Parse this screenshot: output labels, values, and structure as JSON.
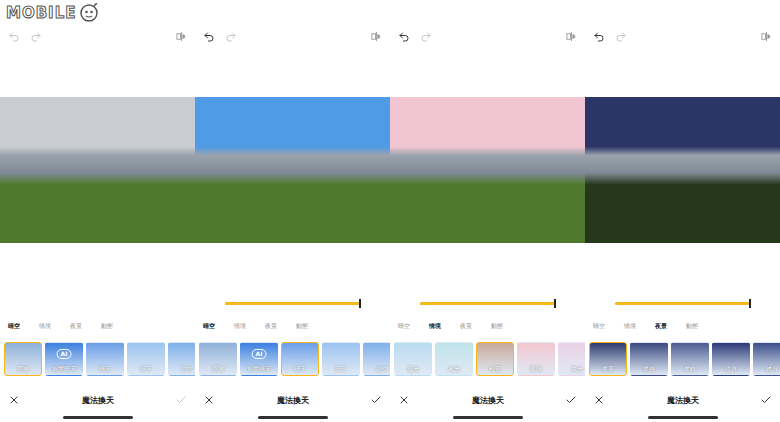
{
  "watermark": {
    "text": "MOBILE"
  },
  "panels": [
    {
      "undo_enabled": false,
      "redo_enabled": false,
      "photo": {
        "sky": "#c9ccd0",
        "ground": "#4f7a2e"
      },
      "slider": null,
      "tabs": [
        {
          "label": "晴空",
          "selected": true
        },
        {
          "label": "情境",
          "selected": false
        },
        {
          "label": "夜景",
          "selected": false
        },
        {
          "label": "動態",
          "selected": false
        }
      ],
      "thumbnails": [
        {
          "label": "原圖",
          "selected": true,
          "color": "#8fb0d8",
          "badge": ""
        },
        {
          "label": "智慧晴天",
          "selected": false,
          "color": "#3a7fe0",
          "badge": "AI"
        },
        {
          "label": "晴天",
          "selected": false,
          "color": "#6a9ee8",
          "badge": ""
        },
        {
          "label": "藍天",
          "selected": false,
          "color": "#9cc3ef",
          "badge": ""
        },
        {
          "label": "碧空",
          "selected": false,
          "color": "#7fb0ea",
          "badge": ""
        }
      ],
      "title": "魔法換天",
      "confirm_enabled": false
    },
    {
      "undo_enabled": true,
      "redo_enabled": false,
      "photo": {
        "sky": "#4f9be6",
        "ground": "#4f7a2e"
      },
      "slider": {
        "level": 1
      },
      "tabs": [
        {
          "label": "晴空",
          "selected": true
        },
        {
          "label": "情境",
          "selected": false
        },
        {
          "label": "夜景",
          "selected": false
        },
        {
          "label": "動態",
          "selected": false
        }
      ],
      "thumbnails": [
        {
          "label": "原圖",
          "selected": false,
          "color": "#8fb0d8",
          "badge": ""
        },
        {
          "label": "智慧晴天",
          "selected": false,
          "color": "#3a7fe0",
          "badge": "AI"
        },
        {
          "label": "晴天",
          "selected": true,
          "color": "#6a9ee8",
          "badge": ""
        },
        {
          "label": "藍天",
          "selected": false,
          "color": "#9cc3ef",
          "badge": ""
        },
        {
          "label": "碧空",
          "selected": false,
          "color": "#7fb0ea",
          "badge": ""
        }
      ],
      "title": "魔法換天",
      "confirm_enabled": true
    },
    {
      "undo_enabled": true,
      "redo_enabled": false,
      "photo": {
        "sky": "#f1c6d2",
        "ground": "#4f7a2e"
      },
      "slider": {
        "level": 1
      },
      "tabs": [
        {
          "label": "晴空",
          "selected": false
        },
        {
          "label": "情境",
          "selected": true
        },
        {
          "label": "夜景",
          "selected": false
        },
        {
          "label": "動態",
          "selected": false
        }
      ],
      "thumbnails": [
        {
          "label": "霞光",
          "selected": false,
          "color": "#b9dcef",
          "badge": ""
        },
        {
          "label": "暮光",
          "selected": false,
          "color": "#bfe3ea",
          "badge": ""
        },
        {
          "label": "粉霞",
          "selected": true,
          "color": "#c9a99a",
          "badge": ""
        },
        {
          "label": "暖陽",
          "selected": false,
          "color": "#f3c7cf",
          "badge": ""
        },
        {
          "label": "晨光",
          "selected": false,
          "color": "#ecd2e6",
          "badge": ""
        }
      ],
      "title": "魔法換天",
      "confirm_enabled": true
    },
    {
      "undo_enabled": true,
      "redo_enabled": false,
      "photo": {
        "sky": "#2b3566",
        "ground": "#26381c"
      },
      "slider": {
        "level": 1
      },
      "tabs": [
        {
          "label": "晴空",
          "selected": false
        },
        {
          "label": "情境",
          "selected": false
        },
        {
          "label": "夜景",
          "selected": true
        },
        {
          "label": "動態",
          "selected": false
        }
      ],
      "thumbnails": [
        {
          "label": "星辰",
          "selected": true,
          "color": "#2e3b6e",
          "badge": ""
        },
        {
          "label": "星跡",
          "selected": false,
          "color": "#3a4a80",
          "badge": ""
        },
        {
          "label": "星軌",
          "selected": false,
          "color": "#4a5c90",
          "badge": ""
        },
        {
          "label": "弦月",
          "selected": false,
          "color": "#2a3a78",
          "badge": ""
        },
        {
          "label": "皓月",
          "selected": false,
          "color": "#3b4f8a",
          "badge": ""
        }
      ],
      "title": "魔法換天",
      "confirm_enabled": true
    }
  ]
}
